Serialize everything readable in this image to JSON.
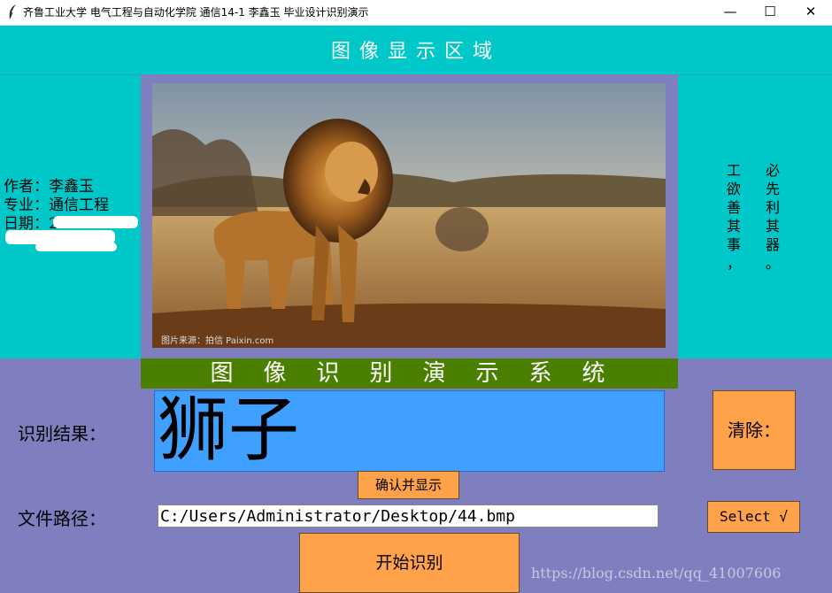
{
  "window": {
    "title": "齐鲁工业大学 电气工程与自动化学院 通信14-1 李鑫玉  毕业设计识别演示",
    "minimize": "—",
    "maximize": "☐",
    "close": "✕"
  },
  "display_title": "图像显示区域",
  "info": {
    "author": "作者：李鑫玉",
    "major": "专业：通信工程",
    "date": "日期：20"
  },
  "quote": {
    "col1": [
      "工",
      "欲",
      "善",
      "其",
      "事",
      "，"
    ],
    "col2": [
      "必",
      "先",
      "利",
      "其",
      "器",
      "。"
    ]
  },
  "image": {
    "subject": "lion-photo",
    "watermark": "图片来源：拍信 Paixin.com"
  },
  "banner": "图像识别演示系统",
  "result": {
    "label": "识别结果：",
    "value": "狮子"
  },
  "buttons": {
    "clear": "清除：",
    "confirm": "确认并显示",
    "select": "Select √",
    "start": "开始识别"
  },
  "path": {
    "label": "文件路径：",
    "value": "C:/Users/Administrator/Desktop/44.bmp"
  },
  "watermark": "https://blog.csdn.net/qq_41007606",
  "colors": {
    "cyan": "#00c8c8",
    "purple": "#7f7fbf",
    "green": "#4a7f00",
    "orange": "#ffa24a",
    "blue": "#3fa0ff"
  }
}
